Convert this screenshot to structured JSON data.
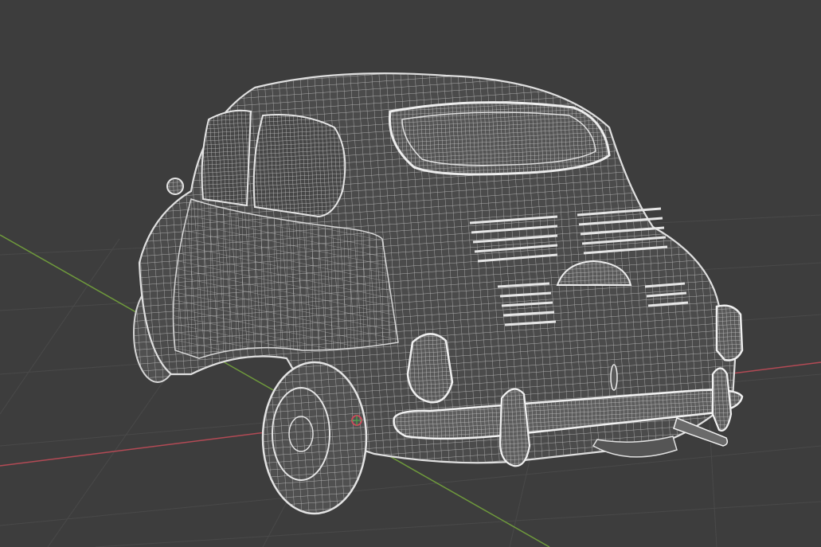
{
  "viewport": {
    "mode": "wireframe",
    "background_color": "#3d3d3d",
    "grid_color": "#4a4a4a",
    "x_axis_color": "#b34a55",
    "y_axis_color": "#6f9a3c",
    "wire_color": "#d6d6d6",
    "shell_color": "#4b4b4b",
    "origin_marker_color": "#d14a5b",
    "object_icon": "car-icon"
  }
}
